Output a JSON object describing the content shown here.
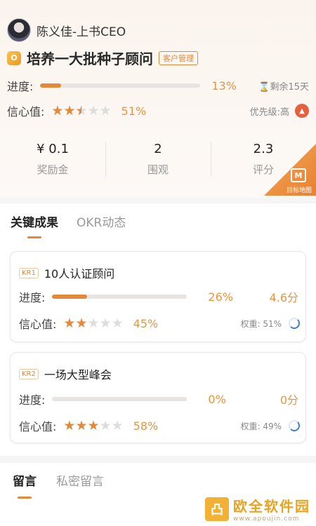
{
  "owner": {
    "name": "陈义佳-上书CEO"
  },
  "objective": {
    "icon_text": "O",
    "title": "培养一大批种子顾问",
    "tag": "客户管理",
    "progress_label": "进度:",
    "progress_percent": 13,
    "progress_text": "13%",
    "remaining": "⌛剩余15天",
    "confidence_label": "信心值:",
    "confidence_stars": 2.5,
    "confidence_text": "51%",
    "priority_label": "优先级:高"
  },
  "stats": [
    {
      "value": "¥ 0.1",
      "label": "奖励金"
    },
    {
      "value": "2",
      "label": "围观"
    },
    {
      "value": "2.3",
      "label": "评分"
    }
  ],
  "corner": {
    "label": "目标地图",
    "icon": "map-icon"
  },
  "tabs": [
    {
      "label": "关键成果"
    },
    {
      "label": "OKR动态"
    }
  ],
  "key_results": [
    {
      "badge": "KR1",
      "title": "10人认证顾问",
      "progress_label": "进度:",
      "progress_percent": 26,
      "progress_text": "26%",
      "score": "4.6分",
      "confidence_label": "信心值:",
      "confidence_stars": 2,
      "confidence_text": "45%",
      "weight": "权重: 51%"
    },
    {
      "badge": "KR2",
      "title": "一场大型峰会",
      "progress_label": "进度:",
      "progress_percent": 0,
      "progress_text": "0%",
      "score": "0分",
      "confidence_label": "信心值:",
      "confidence_stars": 3,
      "confidence_text": "58%",
      "weight": "权重: 49%"
    }
  ],
  "comments": {
    "tabs": [
      {
        "label": "留言"
      },
      {
        "label": "私密留言"
      }
    ]
  },
  "watermark": {
    "logo_text": "凸",
    "text": "欧全软件园",
    "url": "www.apoujin.com"
  },
  "colors": {
    "accent": "#e4883a",
    "priority": "#e5603d",
    "ring": "#3b7ddd"
  }
}
